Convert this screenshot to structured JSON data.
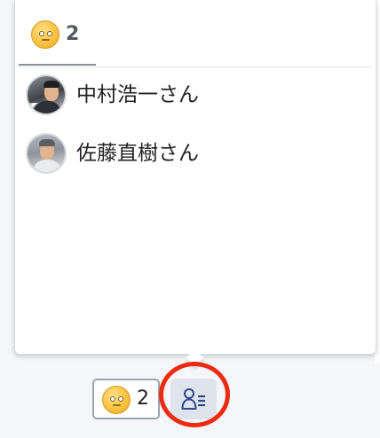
{
  "popover": {
    "tab": {
      "icon": "smiley-emoji-icon",
      "count": "2"
    },
    "users": [
      {
        "name": "中村浩一さん",
        "avatar": "avatar-nakamura"
      },
      {
        "name": "佐藤直樹さん",
        "avatar": "avatar-sato"
      }
    ]
  },
  "reaction_bar": {
    "reaction": {
      "icon": "smiley-emoji-icon",
      "count": "2"
    },
    "viewers_button": {
      "icon": "user-list-icon"
    }
  },
  "colors": {
    "highlight_ring": "#ee2a10",
    "active_tab_underline": "#8a8f97",
    "viewers_button_bg": "#dfe4ec",
    "icon_blue": "#2e4a8a"
  }
}
